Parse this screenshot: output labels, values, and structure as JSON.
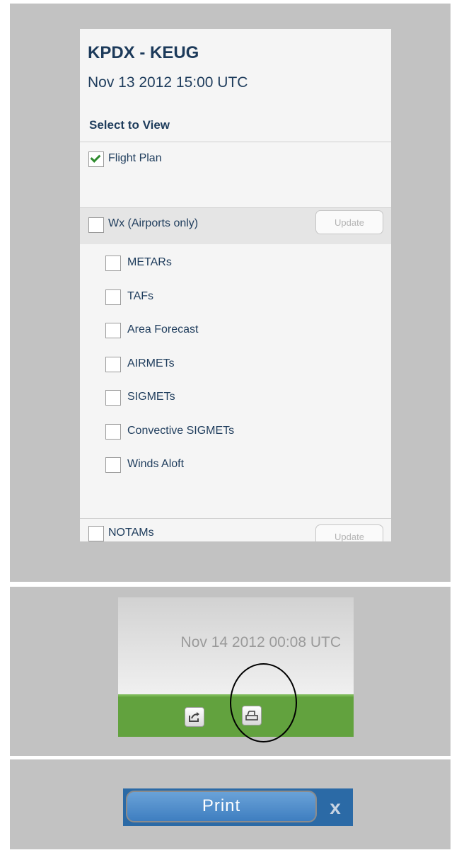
{
  "flight_panel": {
    "route": "KPDX - KEUG",
    "datetime": "Nov 13 2012 15:00 UTC",
    "select_label": "Select to View",
    "flight_plan": {
      "label": "Flight Plan",
      "checked": true
    },
    "wx": {
      "label": "Wx (Airports only)",
      "checked": false,
      "update_label": "Update"
    },
    "wx_items": [
      {
        "label": "METARs",
        "checked": false
      },
      {
        "label": "TAFs",
        "checked": false
      },
      {
        "label": "Area Forecast",
        "checked": false
      },
      {
        "label": "AIRMETs",
        "checked": false
      },
      {
        "label": "SIGMETs",
        "checked": false
      },
      {
        "label": "Convective SIGMETs",
        "checked": false
      },
      {
        "label": "Winds Aloft",
        "checked": false
      }
    ],
    "notams": {
      "label": "NOTAMs",
      "checked": false,
      "update_label": "Update"
    }
  },
  "toolbar_panel": {
    "timestamp": "Nov 14 2012 00:08 UTC",
    "share_icon": "share-icon",
    "print_icon": "print-icon",
    "accent": "#62a23e"
  },
  "print_panel": {
    "print_label": "Print",
    "close_label": "x",
    "accent": "#2b6aa6"
  }
}
